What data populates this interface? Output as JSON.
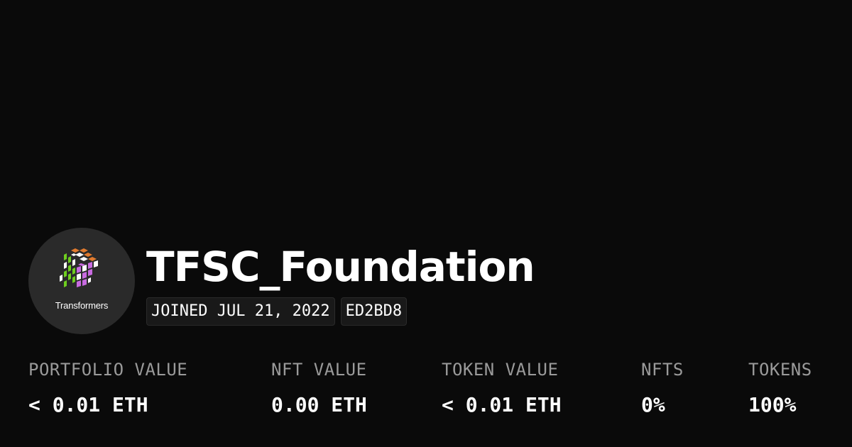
{
  "profile": {
    "avatar_logo_text": "Transformers",
    "avatar_icon": "transformers-cube-logo",
    "username": "TFSC_Foundation",
    "joined": "JOINED JUL 21, 2022",
    "address_tag": "ED2BD8"
  },
  "stats": [
    {
      "label": "PORTFOLIO VALUE",
      "value": "< 0.01 ETH"
    },
    {
      "label": "NFT VALUE",
      "value": "0.00 ETH"
    },
    {
      "label": "TOKEN VALUE",
      "value": "< 0.01 ETH"
    },
    {
      "label": "NFTS",
      "value": "0%"
    },
    {
      "label": "TOKENS",
      "value": "100%"
    }
  ],
  "colors": {
    "background": "#0a0a0a",
    "avatar_bg": "#2a2a2a",
    "label_gray": "#9a9a9a",
    "logo_green": "#6fcf1f",
    "logo_orange": "#e07a2e",
    "logo_purple": "#c86ae0",
    "logo_white": "#ffffff"
  }
}
